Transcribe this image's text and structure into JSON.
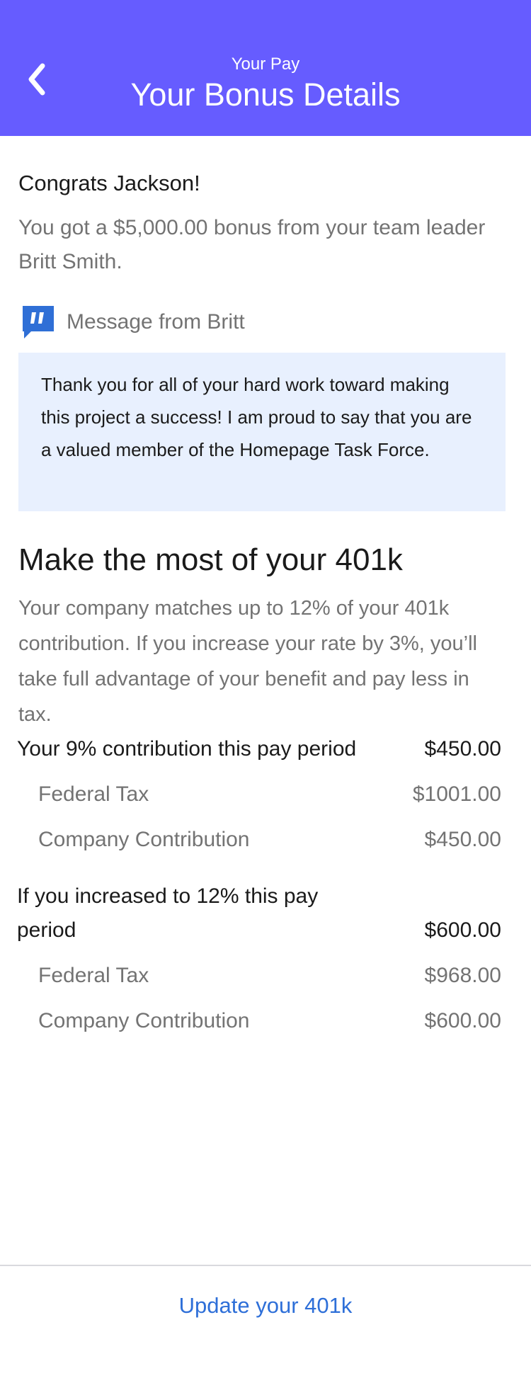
{
  "header": {
    "back_icon": "chevron-left-icon",
    "subtitle": "Your Pay",
    "title": "Your Bonus Details"
  },
  "greeting": "Congrats Jackson!",
  "bonus_text": "You got a $5,000.00 bonus from your team leader Britt Smith.",
  "message": {
    "icon": "quote-icon",
    "label": "Message from Britt",
    "text": "Thank you for all of your hard work toward making this project a success! I am proud to say that you are a valued member of the Homepage Task Force."
  },
  "section_401k": {
    "heading": "Make the most of your 401k",
    "description": "Your company matches up to 12% of your 401k contribution. If you increase your rate by 3%, you’ll take full advantage of your benefit and pay less in tax."
  },
  "current": {
    "label": "Your 9% contribution this pay period",
    "value": "$450.00",
    "federal_tax_label": "Federal Tax",
    "federal_tax_value": "$1001.00",
    "company_label": "Company Contribution",
    "company_value": "$450.00"
  },
  "increased": {
    "label": "If you increased to 12% this pay period",
    "value": "$600.00",
    "federal_tax_label": "Federal Tax",
    "federal_tax_value": "$968.00",
    "company_label": "Company Contribution",
    "company_value": "$600.00"
  },
  "footer": {
    "action_label": "Update your 401k"
  },
  "colors": {
    "header_bg": "#665cff",
    "message_bg": "#e8f0fe",
    "link": "#2e6fd8",
    "quote_icon": "#2f6fd6",
    "muted_text": "#737373"
  }
}
